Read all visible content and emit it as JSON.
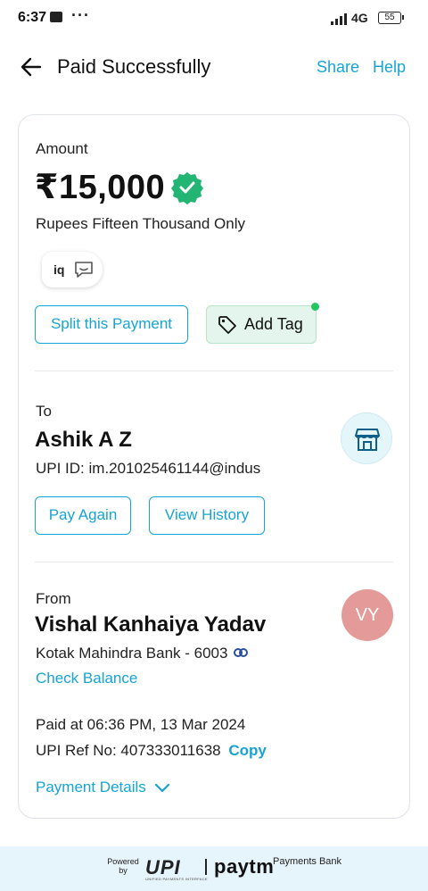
{
  "status_bar": {
    "time": "6:37",
    "network": "4G",
    "battery": "55"
  },
  "header": {
    "title": "Paid Successfully",
    "share": "Share",
    "help": "Help"
  },
  "payment": {
    "amount_label": "Amount",
    "amount": "₹15,000",
    "amount_words": "Rupees Fifteen Thousand Only",
    "iq_label": "iq",
    "split_label": "Split this Payment",
    "add_tag_label": "Add Tag"
  },
  "to": {
    "label": "To",
    "name": "Ashik A Z",
    "upi_id": "UPI ID: im.201025461144@indus",
    "pay_again": "Pay Again",
    "view_history": "View History"
  },
  "from": {
    "label": "From",
    "name": "Vishal Kanhaiya Yadav",
    "bank": "Kotak Mahindra Bank - 6003",
    "check_balance": "Check Balance",
    "initials": "VY"
  },
  "details": {
    "paid_at": "Paid at 06:36 PM, 13 Mar 2024",
    "ref_no": "UPI Ref No: 407333011638",
    "copy": "Copy",
    "payment_details": "Payment Details"
  },
  "footer": {
    "powered_by": "Powered by",
    "upi": "UPI",
    "upi_sub": "UNIFIED PAYMENTS INTERFACE",
    "paytm": "paytm",
    "payments_bank": "Payments Bank"
  },
  "colors": {
    "accent": "#17a3d4",
    "verified": "#22b573",
    "tag_bg": "#e3f5ec",
    "avatar": "#e59a9a"
  }
}
